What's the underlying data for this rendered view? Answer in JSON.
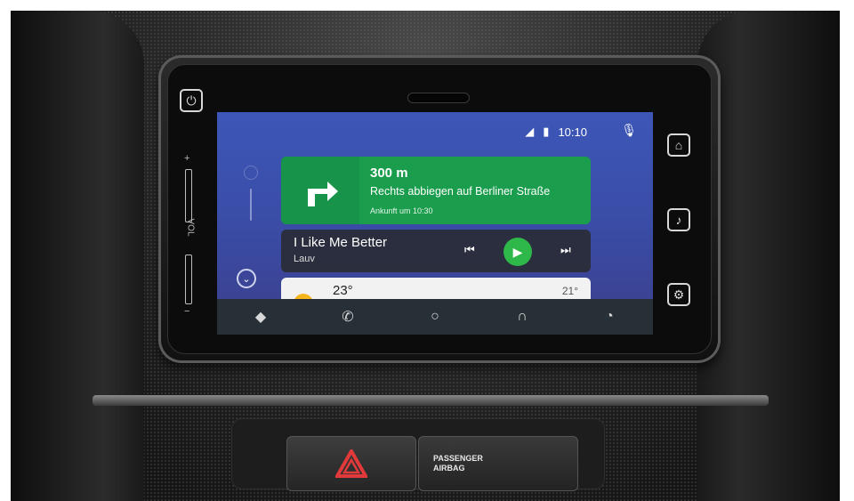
{
  "status_bar": {
    "time": "10:10"
  },
  "navigation_card": {
    "distance": "300 m",
    "instruction": "Rechts abbiegen auf Berliner Straße",
    "eta": "Ankunft um 10:30"
  },
  "media_card": {
    "song": "I Like Me Better",
    "artist": "Lauv"
  },
  "weather_card": {
    "temp_now": "23°",
    "temp_other": "21°"
  },
  "hardware": {
    "vol_label": "VOL",
    "airbag_line1": "PASSENGER",
    "airbag_line2": "AIRBAG"
  },
  "bottom_nav": [
    "navigation-icon",
    "phone-icon",
    "home-circle-icon",
    "headphones-icon",
    "notifications-icon"
  ],
  "colors": {
    "nav_green": "#1a9d4c",
    "play_green": "#2fb84a",
    "screen_blue": "#3d57b8",
    "bar_dark": "#273036"
  }
}
